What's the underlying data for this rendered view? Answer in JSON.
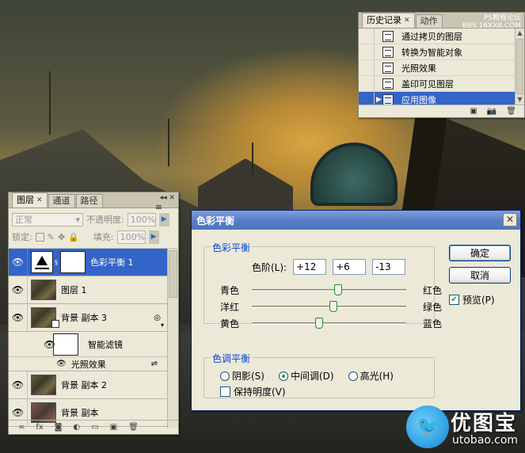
{
  "watermark": {
    "top_left_text": "PS教程论坛",
    "top_right_text": "BBS.16XX8.COM",
    "logo_cn": "优图宝",
    "logo_url": "utobao.com"
  },
  "history_panel": {
    "tabs": [
      {
        "label": "历史记录"
      },
      {
        "label": "动作"
      }
    ],
    "items": [
      {
        "label": "通过拷贝的图层"
      },
      {
        "label": "转换为智能对象"
      },
      {
        "label": "光照效果"
      },
      {
        "label": "盖印可见图层"
      },
      {
        "label": "应用图像",
        "selected": true
      }
    ]
  },
  "layers_panel": {
    "tabs": [
      {
        "label": "图层"
      },
      {
        "label": "通道"
      },
      {
        "label": "路径"
      }
    ],
    "blend_mode": "正常",
    "opacity_label": "不透明度:",
    "opacity_value": "100%",
    "lock_label": "锁定:",
    "fill_label": "填充:",
    "fill_value": "100%",
    "layers": [
      {
        "name": "色彩平衡 1",
        "selected": true
      },
      {
        "name": "图层 1"
      },
      {
        "name": "背景 副本 3"
      },
      {
        "name": "智能滤镜"
      },
      {
        "name": "光照效果"
      },
      {
        "name": "背景 副本 2"
      },
      {
        "name": "背景 副本"
      }
    ]
  },
  "color_balance_dialog": {
    "title": "色彩平衡",
    "group_balance": "色彩平衡",
    "levels_label": "色阶(L):",
    "levels": [
      "+12",
      "+6",
      "-13"
    ],
    "sliders": [
      {
        "left": "青色",
        "right": "红色",
        "value": 12
      },
      {
        "left": "洋红",
        "right": "绿色",
        "value": 6
      },
      {
        "left": "黄色",
        "right": "蓝色",
        "value": -13
      }
    ],
    "group_tone": "色调平衡",
    "tones": [
      {
        "label": "阴影(S)",
        "checked": false
      },
      {
        "label": "中间调(D)",
        "checked": true
      },
      {
        "label": "高光(H)",
        "checked": false
      }
    ],
    "preserve_luminosity": "保持明度(V)",
    "ok": "确定",
    "cancel": "取消",
    "preview": "预览(P)"
  }
}
